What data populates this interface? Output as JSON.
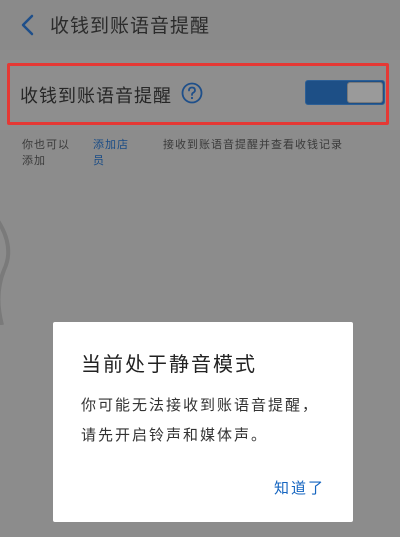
{
  "header": {
    "title": "收钱到账语音提醒",
    "back_icon": "chevron-left-icon"
  },
  "setting": {
    "label": "收钱到账语音提醒",
    "help_icon": "question-circle-icon",
    "toggle_on": true,
    "highlight_color": "#e53935"
  },
  "hints": {
    "left_text": "你也可以添加",
    "link_text": "添加店员",
    "right_text": "接收到账语音提醒并查看收钱记录"
  },
  "dialog": {
    "title": "当前处于静音模式",
    "body": "你可能无法接收到账语音提醒，请先开启铃声和媒体声。",
    "confirm_label": "知道了"
  }
}
